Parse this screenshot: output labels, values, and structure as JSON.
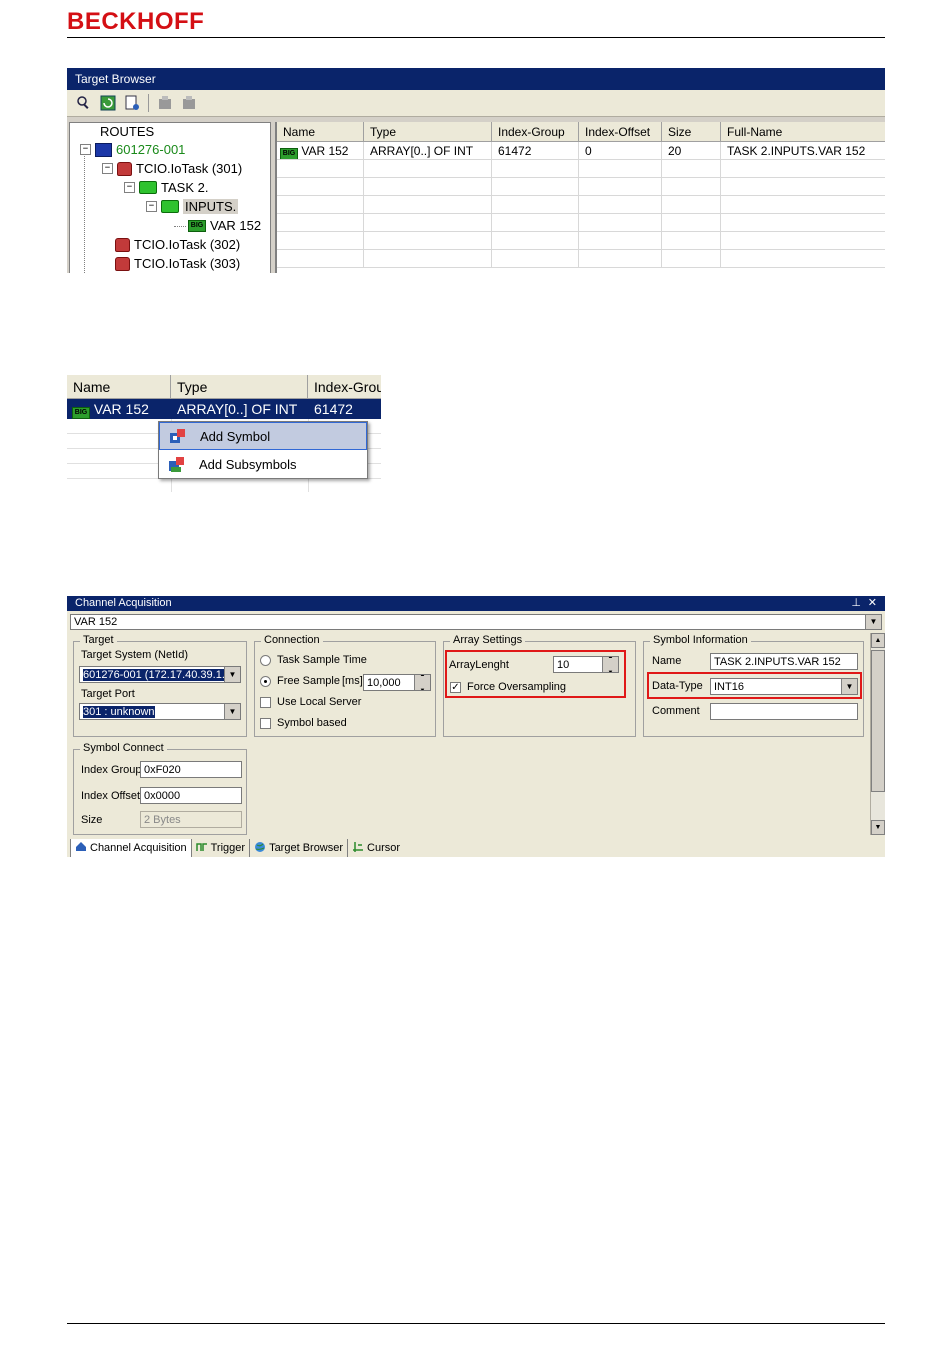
{
  "brand": "BECKHOFF",
  "target_browser": {
    "title": "Target Browser",
    "tree": {
      "routes": "ROUTES",
      "device": "601276-001",
      "task301": "TCIO.IoTask (301)",
      "task2": "TASK 2.",
      "inputs": "INPUTS.",
      "var": "VAR 152",
      "task302": "TCIO.IoTask (302)",
      "task303": "TCIO.IoTask (303)"
    },
    "columns": [
      "Name",
      "Type",
      "Index-Group",
      "Index-Offset",
      "Size",
      "Full-Name"
    ],
    "row": {
      "badge": "BIG",
      "name": "VAR 152",
      "type": "ARRAY[0..] OF INT",
      "index_group": "61472",
      "index_offset": "0",
      "size": "20",
      "full_name": "TASK 2.INPUTS.VAR 152"
    }
  },
  "context": {
    "columns": [
      "Name",
      "Type",
      "Index-Grou"
    ],
    "row": {
      "badge": "BIG",
      "name": "VAR 152",
      "type": "ARRAY[0..] OF INT",
      "index_group": "61472"
    },
    "menu": [
      "Add Symbol",
      "Add Subsymbols"
    ]
  },
  "channel": {
    "title": "Channel Acquisition",
    "selector": "VAR 152",
    "target": {
      "group": "Target",
      "system_label": "Target System (NetId)",
      "system_value": "601276-001 (172.17.40.39.1.1)",
      "port_label": "Target Port",
      "port_value": "301 : unknown"
    },
    "connection": {
      "group": "Connection",
      "task_sample": "Task Sample Time",
      "free_sample": "Free Sample",
      "ms": "[ms]",
      "free_sample_value": "10,000",
      "use_local": "Use Local Server",
      "symbol_based": "Symbol based"
    },
    "array": {
      "group": "Array Settings",
      "length_label": "ArrayLenght",
      "length_value": "10",
      "force": "Force Oversampling"
    },
    "symbol_info": {
      "group": "Symbol Information",
      "name_label": "Name",
      "name_value": "TASK 2.INPUTS.VAR 152",
      "datatype_label": "Data-Type",
      "datatype_value": "INT16",
      "comment_label": "Comment",
      "comment_value": ""
    },
    "symbol_connect": {
      "group": "Symbol Connect",
      "ig_label": "Index Group",
      "ig_value": "0xF020",
      "io_label": "Index Offset",
      "io_value": "0x0000",
      "size_label": "Size",
      "size_value": "2 Bytes"
    },
    "tabs": [
      "Channel Acquisition",
      "Trigger",
      "Target Browser",
      "Cursor"
    ],
    "pin": "⊥",
    "close": "✕"
  },
  "colors": {
    "brand_red": "#d40f14",
    "highlight_red": "#e01818",
    "title_blue": "#0a246a"
  }
}
